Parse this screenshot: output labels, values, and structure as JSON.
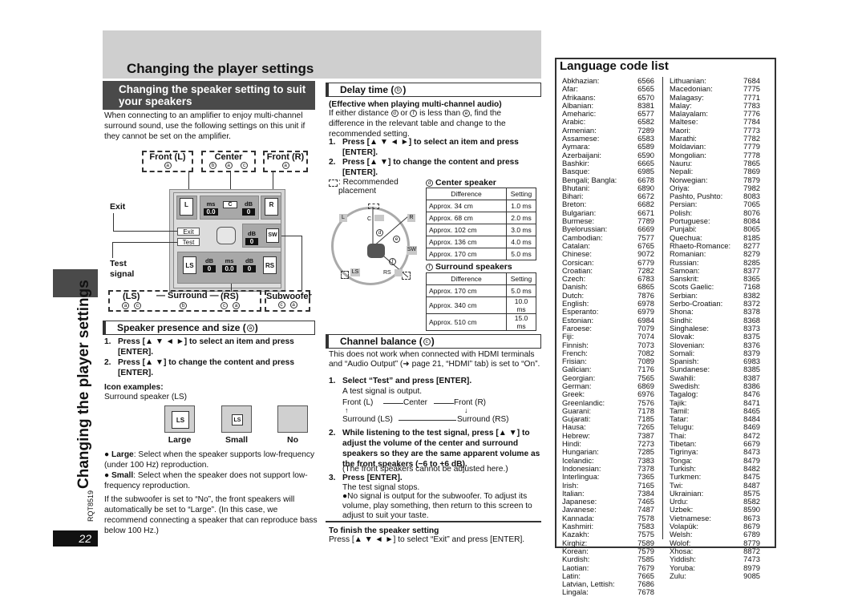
{
  "page": {
    "title": "Changing the player settings",
    "side_title": "Changing the player settings",
    "doc_code": "RQT8519",
    "page_number": "22"
  },
  "speaker_setting": {
    "title": "Changing the speaker setting to suit your speakers",
    "intro": "When connecting to an amplifier to enjoy multi-channel surround sound, use the following settings on this unit if they cannot be set on the amplifier.",
    "diagram": {
      "front_l": {
        "label": "Front (L)",
        "marks": [
          "a"
        ]
      },
      "center": {
        "label": "Center",
        "marks": [
          "b",
          "a",
          "c"
        ]
      },
      "front_r": {
        "label": "Front (R)",
        "marks": [
          "a"
        ]
      },
      "surround_label": "— Surround —",
      "ls": {
        "label": "(LS)",
        "marks": [
          "a",
          "c"
        ]
      },
      "surround_mid_marks": [
        "b"
      ],
      "rs": {
        "label": "(RS)",
        "marks": [
          "c",
          "a"
        ]
      },
      "subwoofer": {
        "label": "Subwoofer",
        "marks": [
          "c",
          "a"
        ]
      },
      "exit_callout": "Exit",
      "test_callout_line1": "Test",
      "test_callout_line2": "signal",
      "osd": {
        "speaker_l": "L",
        "speaker_r": "R",
        "speaker_c": "C",
        "speaker_sw": "SW",
        "speaker_ls": "LS",
        "speaker_rs": "RS",
        "unit_ms": "ms",
        "unit_db": "dB",
        "center_ms": "0.0",
        "center_db": "0",
        "sw_db": "0",
        "ls_db": "0",
        "surround_ms": "0.0",
        "rs_db": "0",
        "exit_button": "Exit",
        "test_button": "Test"
      }
    }
  },
  "presence_size": {
    "title": "Speaker presence and size (",
    "mark": "a",
    "title_end": ")",
    "steps": [
      {
        "n": "1.",
        "text": "Press [▲ ▼ ◄ ►] to select an item and press [ENTER]."
      },
      {
        "n": "2.",
        "text": "Press [▲ ▼] to change the content and press [ENTER]."
      }
    ],
    "icon_examples_title": "Icon examples:",
    "icon_examples_sub": "Surround speaker (LS)",
    "icons": [
      {
        "caption": "Large",
        "label": "LS"
      },
      {
        "caption": "Small",
        "label": "LS"
      },
      {
        "caption": "No",
        "label": ""
      }
    ],
    "bullets": [
      {
        "term": "Large",
        "text": ": Select when the speaker supports low-frequency (under 100 Hz) reproduction."
      },
      {
        "term": "Small",
        "text": ": Select when the speaker does not support low-frequency reproduction."
      }
    ],
    "note": "If the subwoofer is set to “No”, the front speakers will automatically be set to “Large”. (In this case, we recommend connecting a speaker that can reproduce bass below 100 Hz.)"
  },
  "delay_time": {
    "title": "Delay time (",
    "mark": "b",
    "title_end": ")",
    "subtitle": "(Effective when playing multi-channel audio)",
    "text_parts": [
      "If either distance ",
      "d",
      " or ",
      "f",
      " is less than ",
      "e",
      ", find the difference in the relevant table and change to the recommended setting."
    ],
    "steps": [
      {
        "n": "1.",
        "text": "Press [▲ ▼ ◄ ►] to select an item and press [ENTER]."
      },
      {
        "n": "2.",
        "text": "Press [▲ ▼] to change the content and press [ENTER]."
      }
    ],
    "legend": ": Recommended placement",
    "diagram_labels": {
      "l": "L",
      "c": "C",
      "r": "R",
      "sw": "SW",
      "ls": "LS",
      "rs": "RS",
      "d": "d",
      "e": "e",
      "f": "f"
    },
    "center_table": {
      "mark": "d",
      "title": "Center speaker",
      "headers": [
        "Difference",
        "Setting"
      ],
      "rows": [
        [
          "Approx. 34 cm",
          "1.0 ms"
        ],
        [
          "Approx. 68 cm",
          "2.0 ms"
        ],
        [
          "Approx. 102 cm",
          "3.0 ms"
        ],
        [
          "Approx. 136 cm",
          "4.0 ms"
        ],
        [
          "Approx. 170 cm",
          "5.0 ms"
        ]
      ]
    },
    "surround_table": {
      "mark": "f",
      "title": "Surround speakers",
      "headers": [
        "Difference",
        "Setting"
      ],
      "rows": [
        [
          "Approx. 170 cm",
          "5.0 ms"
        ],
        [
          "Approx. 340 cm",
          "10.0 ms"
        ],
        [
          "Approx. 510 cm",
          "15.0 ms"
        ]
      ]
    }
  },
  "channel_balance": {
    "title": "Channel balance (",
    "mark": "c",
    "title_end": ")",
    "intro": "This does not work when connected with HDMI terminals and “Audio Output” (➜ page 21, “HDMI” tab) is set to “On”.",
    "step1": {
      "n": "1.",
      "text": "Select “Test” and press [ENTER]."
    },
    "step1_sub": "A test signal is output.",
    "flow": {
      "front_l": "Front (L)",
      "center": "Center",
      "front_r": "Front (R)",
      "surround_ls": "Surround (LS)",
      "surround_rs": "Surround (RS)"
    },
    "step2": {
      "n": "2.",
      "text": "While listening to the test signal, press [▲ ▼] to adjust the volume of the center and surround speakers so they are the same apparent volume as the front speakers (−6 to +6 dB)."
    },
    "step2_sub": "(The front speakers cannot be adjusted here.)",
    "step3": {
      "n": "3.",
      "text": "Press [ENTER]."
    },
    "step3_sub": "The test signal stops.",
    "step3_bullet": "●No signal is output for the subwoofer. To adjust its volume, play something, then return to this screen to adjust to suit your taste."
  },
  "finish": {
    "title": "To finish the speaker setting",
    "text": "Press [▲ ▼ ◄ ►] to select “Exit” and press [ENTER]."
  },
  "language_list": {
    "title": "Language code list",
    "left": [
      [
        "Abkhazian:",
        "6566"
      ],
      [
        "Afar:",
        "6565"
      ],
      [
        "Afrikaans:",
        "6570"
      ],
      [
        "Albanian:",
        "8381"
      ],
      [
        "Ameharic:",
        "6577"
      ],
      [
        "Arabic:",
        "6582"
      ],
      [
        "Armenian:",
        "7289"
      ],
      [
        "Assamese:",
        "6583"
      ],
      [
        "Aymara:",
        "6589"
      ],
      [
        "Azerbaijani:",
        "6590"
      ],
      [
        "Bashkir:",
        "6665"
      ],
      [
        "Basque:",
        "6985"
      ],
      [
        "Bengali; Bangla:",
        "6678"
      ],
      [
        "Bhutani:",
        "6890"
      ],
      [
        "Bihari:",
        "6672"
      ],
      [
        "Breton:",
        "6682"
      ],
      [
        "Bulgarian:",
        "6671"
      ],
      [
        "Burmese:",
        "7789"
      ],
      [
        "Byelorussian:",
        "6669"
      ],
      [
        "Cambodian:",
        "7577"
      ],
      [
        "Catalan:",
        "6765"
      ],
      [
        "Chinese:",
        "9072"
      ],
      [
        "Corsican:",
        "6779"
      ],
      [
        "Croatian:",
        "7282"
      ],
      [
        "Czech:",
        "6783"
      ],
      [
        "Danish:",
        "6865"
      ],
      [
        "Dutch:",
        "7876"
      ],
      [
        "English:",
        "6978"
      ],
      [
        "Esperanto:",
        "6979"
      ],
      [
        "Estonian:",
        "6984"
      ],
      [
        "Faroese:",
        "7079"
      ],
      [
        "Fiji:",
        "7074"
      ],
      [
        "Finnish:",
        "7073"
      ],
      [
        "French:",
        "7082"
      ],
      [
        "Frisian:",
        "7089"
      ],
      [
        "Galician:",
        "7176"
      ],
      [
        "Georgian:",
        "7565"
      ],
      [
        "German:",
        "6869"
      ],
      [
        "Greek:",
        "6976"
      ],
      [
        "Greenlandic:",
        "7576"
      ],
      [
        "Guarani:",
        "7178"
      ],
      [
        "Gujarati:",
        "7185"
      ],
      [
        "Hausa:",
        "7265"
      ],
      [
        "Hebrew:",
        "7387"
      ],
      [
        "Hindi:",
        "7273"
      ],
      [
        "Hungarian:",
        "7285"
      ],
      [
        "Icelandic:",
        "7383"
      ],
      [
        "Indonesian:",
        "7378"
      ],
      [
        "Interlingua:",
        "7365"
      ],
      [
        "Irish:",
        "7165"
      ],
      [
        "Italian:",
        "7384"
      ],
      [
        "Japanese:",
        "7465"
      ],
      [
        "Javanese:",
        "7487"
      ],
      [
        "Kannada:",
        "7578"
      ],
      [
        "Kashmiri:",
        "7583"
      ],
      [
        "Kazakh:",
        "7575"
      ],
      [
        "Kirghiz:",
        "7589"
      ],
      [
        "Korean:",
        "7579"
      ],
      [
        "Kurdish:",
        "7585"
      ],
      [
        "Laotian:",
        "7679"
      ],
      [
        "Latin:",
        "7665"
      ],
      [
        "Latvian, Lettish:",
        "7686"
      ],
      [
        "Lingala:",
        "7678"
      ]
    ],
    "right": [
      [
        "Lithuanian:",
        "7684"
      ],
      [
        "Macedonian:",
        "7775"
      ],
      [
        "Malagasy:",
        "7771"
      ],
      [
        "Malay:",
        "7783"
      ],
      [
        "Malayalam:",
        "7776"
      ],
      [
        "Maltese:",
        "7784"
      ],
      [
        "Maori:",
        "7773"
      ],
      [
        "Marathi:",
        "7782"
      ],
      [
        "Moldavian:",
        "7779"
      ],
      [
        "Mongolian:",
        "7778"
      ],
      [
        "Nauru:",
        "7865"
      ],
      [
        "Nepali:",
        "7869"
      ],
      [
        "Norwegian:",
        "7879"
      ],
      [
        "Oriya:",
        "7982"
      ],
      [
        "Pashto, Pushto:",
        "8083"
      ],
      [
        "Persian:",
        "7065"
      ],
      [
        "Polish:",
        "8076"
      ],
      [
        "Portuguese:",
        "8084"
      ],
      [
        "Punjabi:",
        "8065"
      ],
      [
        "Quechua:",
        "8185"
      ],
      [
        "Rhaeto-Romance:",
        "8277"
      ],
      [
        "Romanian:",
        "8279"
      ],
      [
        "Russian:",
        "8285"
      ],
      [
        "Samoan:",
        "8377"
      ],
      [
        "Sanskrit:",
        "8365"
      ],
      [
        "Scots Gaelic:",
        "7168"
      ],
      [
        "Serbian:",
        "8382"
      ],
      [
        "Serbo-Croatian:",
        "8372"
      ],
      [
        "Shona:",
        "8378"
      ],
      [
        "Sindhi:",
        "8368"
      ],
      [
        "Singhalese:",
        "8373"
      ],
      [
        "Slovak:",
        "8375"
      ],
      [
        "Slovenian:",
        "8376"
      ],
      [
        "Somali:",
        "8379"
      ],
      [
        "Spanish:",
        "6983"
      ],
      [
        "Sundanese:",
        "8385"
      ],
      [
        "Swahili:",
        "8387"
      ],
      [
        "Swedish:",
        "8386"
      ],
      [
        "Tagalog:",
        "8476"
      ],
      [
        "Tajik:",
        "8471"
      ],
      [
        "Tamil:",
        "8465"
      ],
      [
        "Tatar:",
        "8484"
      ],
      [
        "Telugu:",
        "8469"
      ],
      [
        "Thai:",
        "8472"
      ],
      [
        "Tibetan:",
        "6679"
      ],
      [
        "Tigrinya:",
        "8473"
      ],
      [
        "Tonga:",
        "8479"
      ],
      [
        "Turkish:",
        "8482"
      ],
      [
        "Turkmen:",
        "8475"
      ],
      [
        "Twi:",
        "8487"
      ],
      [
        "Ukrainian:",
        "8575"
      ],
      [
        "Urdu:",
        "8582"
      ],
      [
        "Uzbek:",
        "8590"
      ],
      [
        "Vietnamese:",
        "8673"
      ],
      [
        "Volapük:",
        "8679"
      ],
      [
        "Welsh:",
        "6789"
      ],
      [
        "Wolof:",
        "8779"
      ],
      [
        "Xhosa:",
        "8872"
      ],
      [
        "Yiddish:",
        "7473"
      ],
      [
        "Yoruba:",
        "8979"
      ],
      [
        "Zulu:",
        "9085"
      ]
    ]
  }
}
